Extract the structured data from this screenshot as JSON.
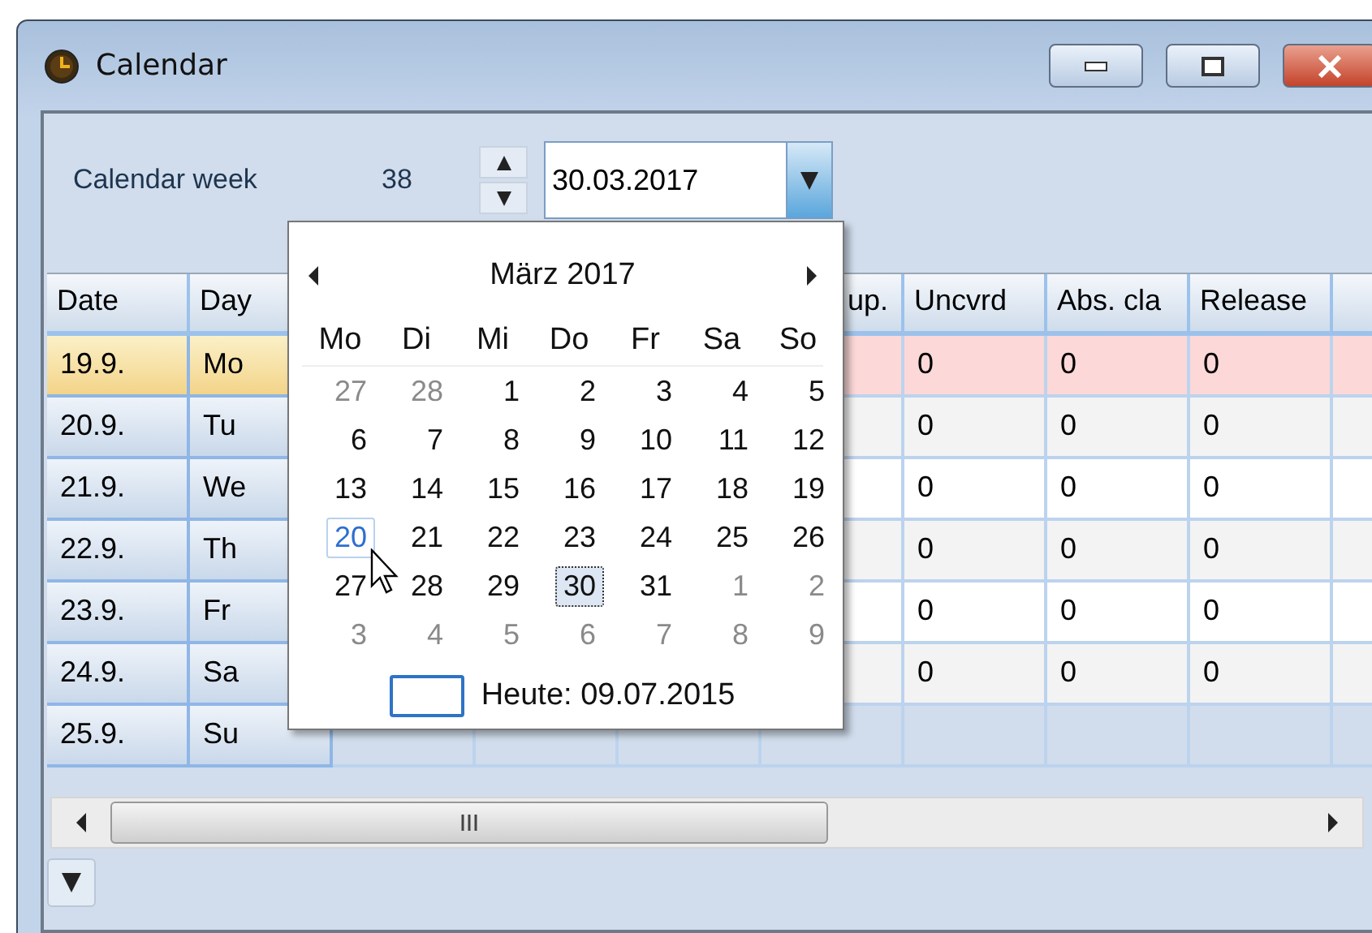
{
  "window": {
    "title": "Calendar"
  },
  "toolbar": {
    "week_label": "Calendar week",
    "week_value": "38",
    "date_value": "30.03.2017"
  },
  "table": {
    "columns": [
      "Date",
      "Day",
      "up.",
      "Uncvrd",
      "Abs. cla",
      "Release"
    ],
    "rows": [
      {
        "date": "19.9.",
        "day": "Mo",
        "values": [
          "0",
          "0",
          "0"
        ],
        "selected": true
      },
      {
        "date": "20.9.",
        "day": "Tu",
        "values": [
          "0",
          "0",
          "0"
        ],
        "selected": false
      },
      {
        "date": "21.9.",
        "day": "We",
        "values": [
          "0",
          "0",
          "0"
        ],
        "selected": false
      },
      {
        "date": "22.9.",
        "day": "Th",
        "values": [
          "0",
          "0",
          "0"
        ],
        "selected": false
      },
      {
        "date": "23.9.",
        "day": "Fr",
        "values": [
          "0",
          "0",
          "0"
        ],
        "selected": false
      },
      {
        "date": "24.9.",
        "day": "Sa",
        "values": [
          "0",
          "0",
          "0"
        ],
        "selected": false
      },
      {
        "date": "25.9.",
        "day": "Su",
        "values": [],
        "selected": false
      }
    ]
  },
  "calendar_popup": {
    "month": "März 2017",
    "weekdays": [
      "Mo",
      "Di",
      "Mi",
      "Do",
      "Fr",
      "Sa",
      "So"
    ],
    "weeks": [
      [
        {
          "day": "27",
          "muted": true,
          "selected": false,
          "hovered": false
        },
        {
          "day": "28",
          "muted": true,
          "selected": false,
          "hovered": false
        },
        {
          "day": "1",
          "muted": false,
          "selected": false,
          "hovered": false
        },
        {
          "day": "2",
          "muted": false,
          "selected": false,
          "hovered": false
        },
        {
          "day": "3",
          "muted": false,
          "selected": false,
          "hovered": false
        },
        {
          "day": "4",
          "muted": false,
          "selected": false,
          "hovered": false
        },
        {
          "day": "5",
          "muted": false,
          "selected": false,
          "hovered": false
        }
      ],
      [
        {
          "day": "6",
          "muted": false,
          "selected": false,
          "hovered": false
        },
        {
          "day": "7",
          "muted": false,
          "selected": false,
          "hovered": false
        },
        {
          "day": "8",
          "muted": false,
          "selected": false,
          "hovered": false
        },
        {
          "day": "9",
          "muted": false,
          "selected": false,
          "hovered": false
        },
        {
          "day": "10",
          "muted": false,
          "selected": false,
          "hovered": false
        },
        {
          "day": "11",
          "muted": false,
          "selected": false,
          "hovered": false
        },
        {
          "day": "12",
          "muted": false,
          "selected": false,
          "hovered": false
        }
      ],
      [
        {
          "day": "13",
          "muted": false,
          "selected": false,
          "hovered": false
        },
        {
          "day": "14",
          "muted": false,
          "selected": false,
          "hovered": false
        },
        {
          "day": "15",
          "muted": false,
          "selected": false,
          "hovered": false
        },
        {
          "day": "16",
          "muted": false,
          "selected": false,
          "hovered": false
        },
        {
          "day": "17",
          "muted": false,
          "selected": false,
          "hovered": false
        },
        {
          "day": "18",
          "muted": false,
          "selected": false,
          "hovered": false
        },
        {
          "day": "19",
          "muted": false,
          "selected": false,
          "hovered": false
        }
      ],
      [
        {
          "day": "20",
          "muted": false,
          "selected": false,
          "hovered": true
        },
        {
          "day": "21",
          "muted": false,
          "selected": false,
          "hovered": false
        },
        {
          "day": "22",
          "muted": false,
          "selected": false,
          "hovered": false
        },
        {
          "day": "23",
          "muted": false,
          "selected": false,
          "hovered": false
        },
        {
          "day": "24",
          "muted": false,
          "selected": false,
          "hovered": false
        },
        {
          "day": "25",
          "muted": false,
          "selected": false,
          "hovered": false
        },
        {
          "day": "26",
          "muted": false,
          "selected": false,
          "hovered": false
        }
      ],
      [
        {
          "day": "27",
          "muted": false,
          "selected": false,
          "hovered": false
        },
        {
          "day": "28",
          "muted": false,
          "selected": false,
          "hovered": false
        },
        {
          "day": "29",
          "muted": false,
          "selected": false,
          "hovered": false
        },
        {
          "day": "30",
          "muted": false,
          "selected": true,
          "hovered": false
        },
        {
          "day": "31",
          "muted": false,
          "selected": false,
          "hovered": false
        },
        {
          "day": "1",
          "muted": true,
          "selected": false,
          "hovered": false
        },
        {
          "day": "2",
          "muted": true,
          "selected": false,
          "hovered": false
        }
      ],
      [
        {
          "day": "3",
          "muted": true,
          "selected": false,
          "hovered": false
        },
        {
          "day": "4",
          "muted": true,
          "selected": false,
          "hovered": false
        },
        {
          "day": "5",
          "muted": true,
          "selected": false,
          "hovered": false
        },
        {
          "day": "6",
          "muted": true,
          "selected": false,
          "hovered": false
        },
        {
          "day": "7",
          "muted": true,
          "selected": false,
          "hovered": false
        },
        {
          "day": "8",
          "muted": true,
          "selected": false,
          "hovered": false
        },
        {
          "day": "9",
          "muted": true,
          "selected": false,
          "hovered": false
        }
      ]
    ],
    "today_label": "Heute: 09.07.2015"
  }
}
